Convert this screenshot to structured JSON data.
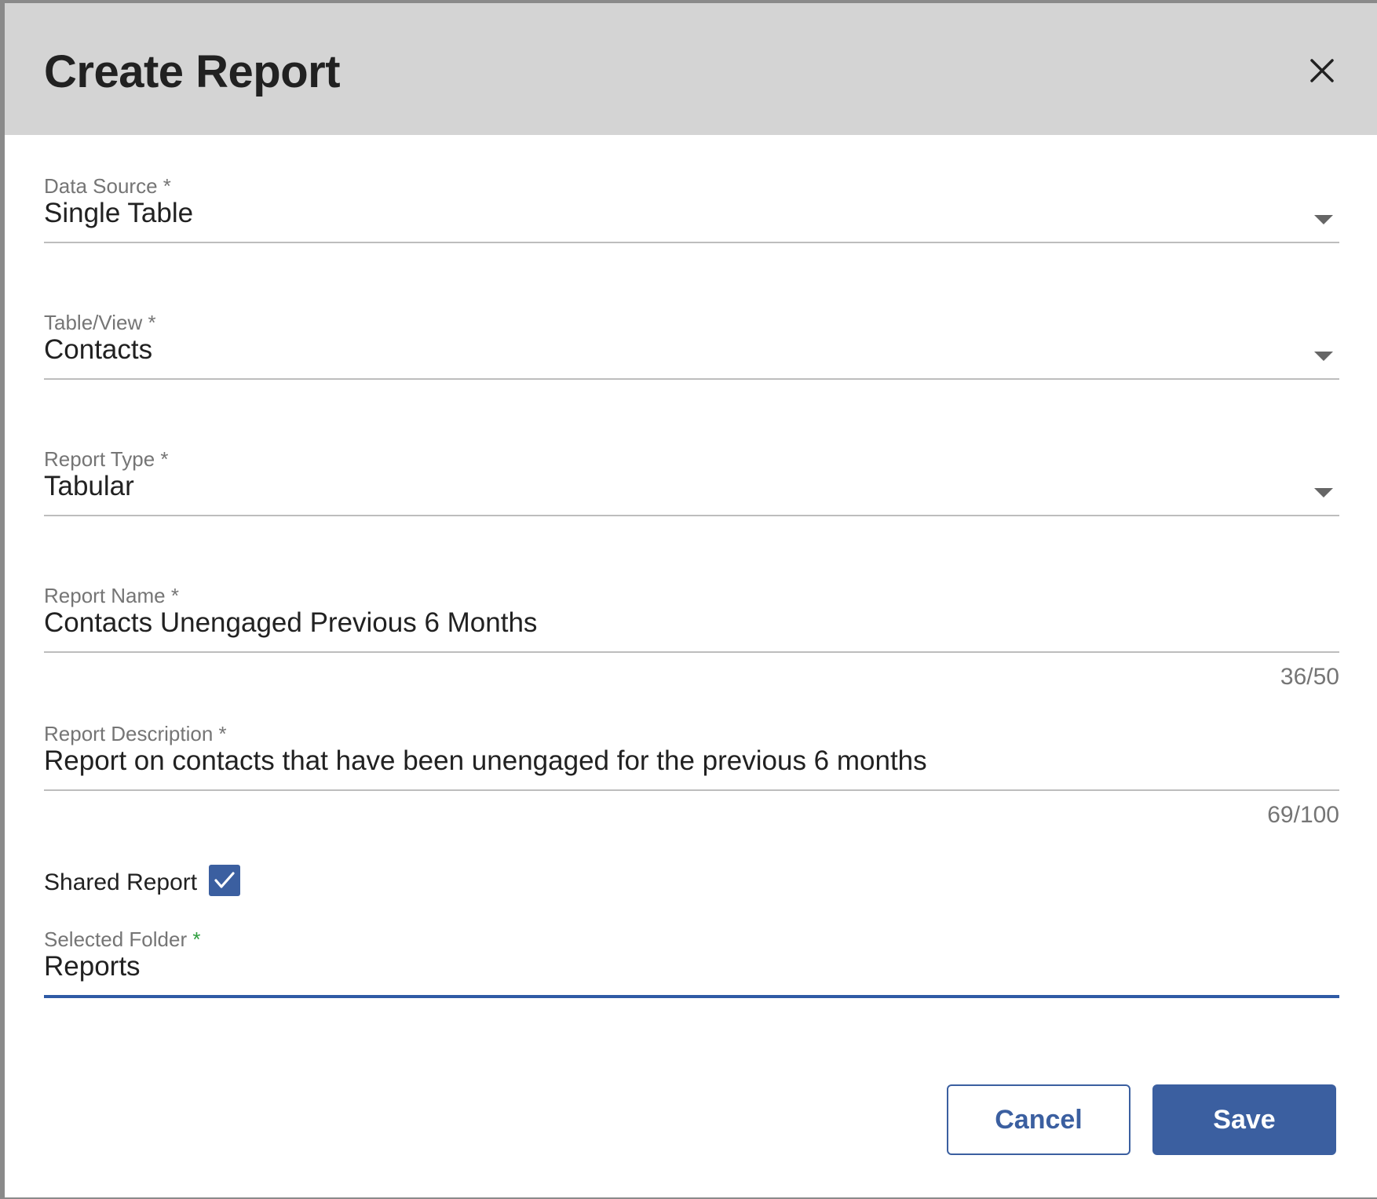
{
  "dialog": {
    "title": "Create Report",
    "close_icon": "close-icon"
  },
  "fields": {
    "data_source": {
      "label": "Data Source",
      "required": "*",
      "value": "Single Table"
    },
    "table_view": {
      "label": "Table/View",
      "required": "*",
      "value": "Contacts"
    },
    "report_type": {
      "label": "Report Type",
      "required": "*",
      "value": "Tabular"
    },
    "report_name": {
      "label": "Report Name",
      "required": "*",
      "value": "Contacts Unengaged Previous 6 Months",
      "counter": "36/50"
    },
    "report_description": {
      "label": "Report Description",
      "required": "*",
      "value": "Report on contacts that have been unengaged for the previous 6 months",
      "counter": "69/100"
    },
    "shared_report": {
      "label": "Shared Report",
      "checked": true
    },
    "selected_folder": {
      "label": "Selected Folder",
      "required": "*",
      "value": "Reports"
    }
  },
  "actions": {
    "cancel_label": "Cancel",
    "save_label": "Save"
  },
  "colors": {
    "accent": "#3b5fa0",
    "header_bg": "#d4d4d4",
    "required_green": "#2e9e3e"
  }
}
